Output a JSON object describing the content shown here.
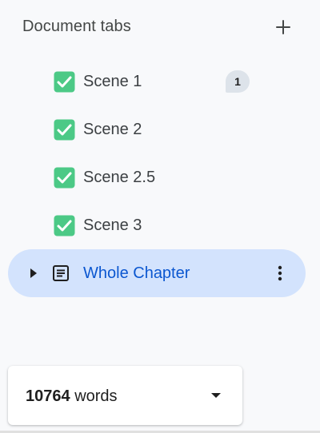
{
  "header": {
    "title": "Document tabs",
    "add_icon": "plus-icon"
  },
  "tabs": [
    {
      "label": "Scene 1",
      "icon": "check-box-icon",
      "comments": "1"
    },
    {
      "label": "Scene 2",
      "icon": "check-box-icon"
    },
    {
      "label": "Scene 2.5",
      "icon": "check-box-icon"
    },
    {
      "label": "Scene 3",
      "icon": "check-box-icon"
    }
  ],
  "active_tab": {
    "label": "Whole Chapter",
    "icon": "document-icon",
    "expand_icon": "triangle-right-icon",
    "more_icon": "more-vertical-icon"
  },
  "word_count": {
    "number": "10764",
    "unit": "words",
    "dropdown_icon": "caret-down-icon"
  },
  "colors": {
    "active_bg": "#d3e3fd",
    "active_text": "#0b57d0",
    "check_green": "#4cc986",
    "badge_bg": "#dde3ea"
  }
}
